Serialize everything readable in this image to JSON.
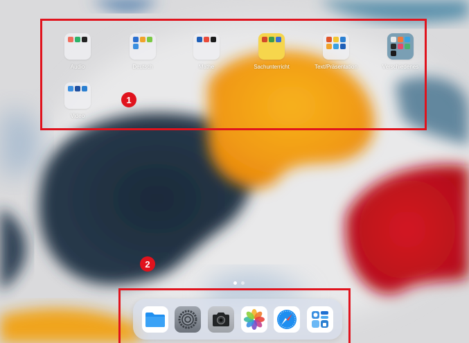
{
  "folders": [
    {
      "label": "Audio"
    },
    {
      "label": "Deutsch"
    },
    {
      "label": "Mathe"
    },
    {
      "label": "Sachunterricht"
    },
    {
      "label": "Text/Präsentation"
    },
    {
      "label": "Verschiedenes"
    },
    {
      "label": "Video"
    }
  ],
  "annotations": {
    "badge1": "1",
    "badge2": "2"
  },
  "page_indicator": {
    "pages": 2,
    "current": 1
  },
  "dock": {
    "apps": [
      {
        "icon": "files-icon"
      },
      {
        "icon": "settings-icon"
      },
      {
        "icon": "camera-icon"
      },
      {
        "icon": "photos-icon"
      },
      {
        "icon": "safari-icon"
      },
      {
        "icon": "app-folder-icon"
      }
    ]
  },
  "colors": {
    "annotation_red": "#e0131d",
    "sachunterricht_folder": "#f6d64c",
    "verschiedenes_folder": "#7a9fb4"
  }
}
